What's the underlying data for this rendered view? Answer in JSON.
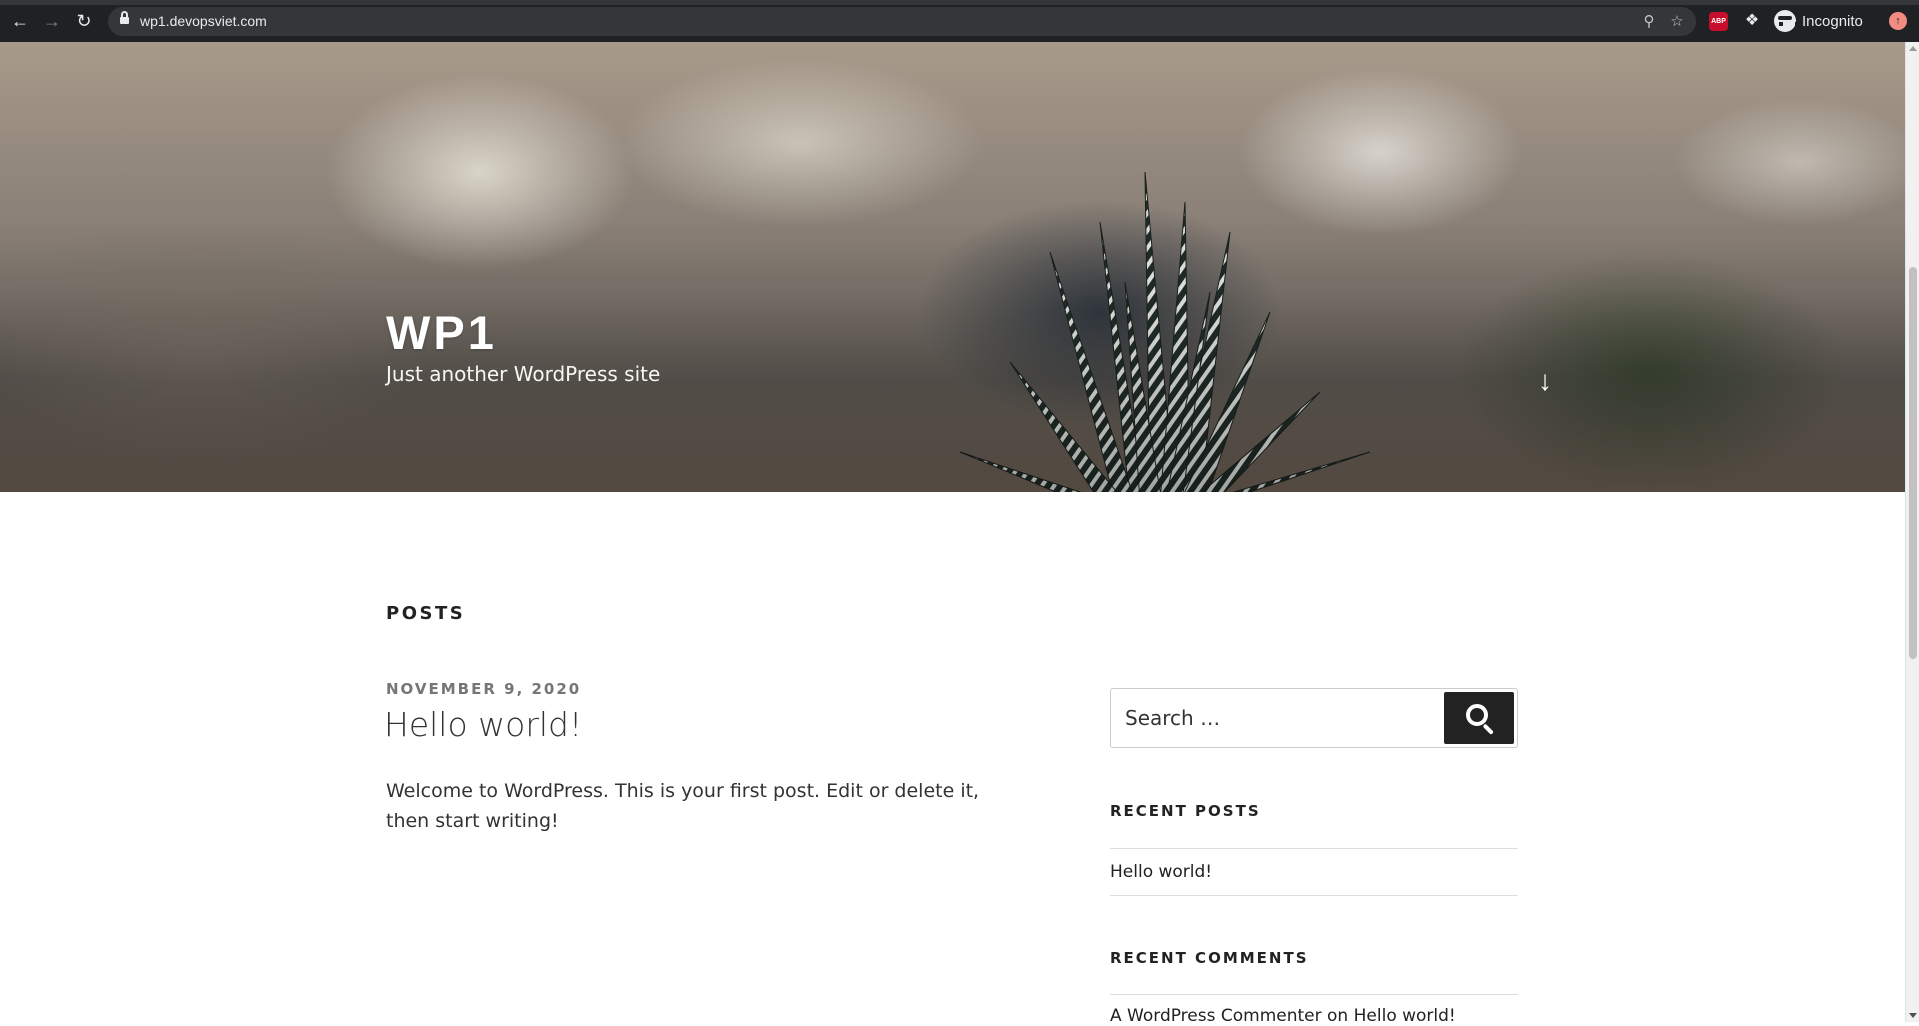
{
  "browser": {
    "url": "wp1.devopsviet.com",
    "profile_label": "Incognito",
    "extension_abp_label": "ABP",
    "icons": [
      "back-arrow-icon",
      "forward-arrow-icon",
      "reload-icon",
      "lock-icon",
      "zoom-icon",
      "star-icon",
      "puzzle-icon",
      "incognito-icon",
      "update-icon"
    ]
  },
  "site": {
    "title": "WP1",
    "description": "Just another WordPress site"
  },
  "main": {
    "posts_heading": "POSTS",
    "post": {
      "date": "NOVEMBER 9, 2020",
      "title": "Hello world!",
      "excerpt": "Welcome to WordPress. This is your first post. Edit or delete it, then start writing!"
    }
  },
  "sidebar": {
    "search": {
      "placeholder": "Search …"
    },
    "recent_posts": {
      "title": "RECENT POSTS",
      "items": [
        {
          "label": "Hello world!"
        }
      ]
    },
    "recent_comments": {
      "title": "RECENT COMMENTS",
      "items": [
        {
          "author": "A WordPress Commenter",
          "connector": "on",
          "post": "Hello world!"
        }
      ]
    }
  },
  "colors": {
    "chrome_bg": "#202124",
    "omnibox_bg": "#35363a",
    "text_dark": "#222222",
    "date_gray": "#767676",
    "button_dark": "#222222"
  }
}
